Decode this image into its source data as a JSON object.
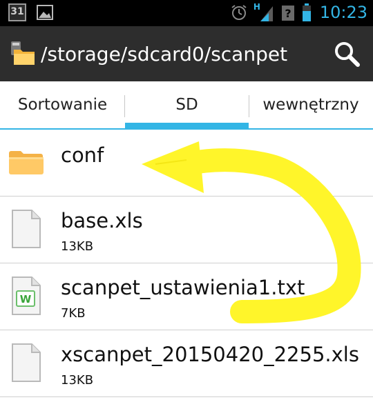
{
  "status_bar": {
    "calendar_day": "31",
    "network_label": "H",
    "time": "10:23"
  },
  "action_bar": {
    "path": "/storage/sdcard0/scanpet"
  },
  "tabs": [
    {
      "label": "Sortowanie",
      "selected": false
    },
    {
      "label": "SD",
      "selected": true
    },
    {
      "label": "wewnętrzny",
      "selected": false
    }
  ],
  "files": [
    {
      "name": "conf",
      "size": "",
      "icon": "folder-icon"
    },
    {
      "name": "base.xls",
      "size": "13KB",
      "icon": "file-icon"
    },
    {
      "name": "scanpet_ustawienia1.txt",
      "size": "7KB",
      "icon": "word-document-icon"
    },
    {
      "name": "xscanpet_20150420_2255.xls",
      "size": "13KB",
      "icon": "file-icon"
    }
  ],
  "colors": {
    "accent": "#33b5e5",
    "action_bar": "#2d2d2d",
    "annotation_arrow": "#fff52a"
  }
}
